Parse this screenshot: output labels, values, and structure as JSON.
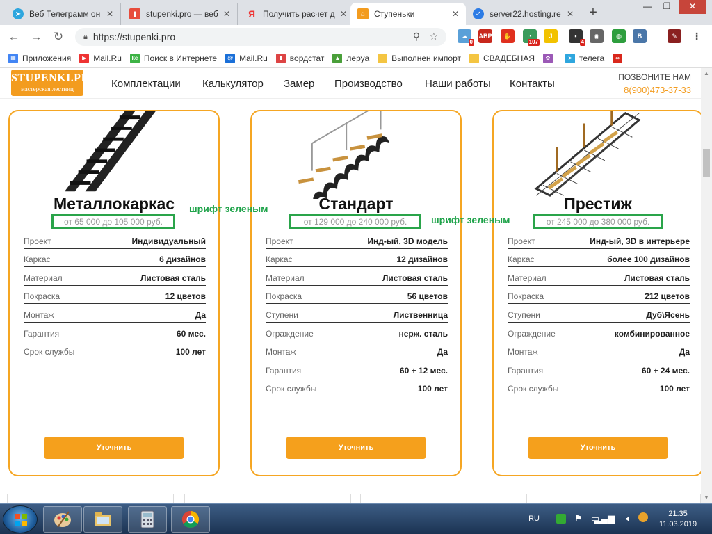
{
  "browser": {
    "tabs": [
      {
        "title": "Веб Телеграмм он",
        "fav_color": "#2ea6de",
        "fav_glyph": "➤"
      },
      {
        "title": "stupenki.pro — веб",
        "fav_color": "#e74c3c",
        "fav_glyph": "▮"
      },
      {
        "title": "Получить расчет д",
        "fav_color": "#ffffff",
        "fav_glyph": "Я"
      },
      {
        "title": "Ступеньки",
        "fav_color": "#f39c1f",
        "fav_glyph": "⌂"
      },
      {
        "title": "server22.hosting.re",
        "fav_color": "#2c7be5",
        "fav_glyph": "✓"
      }
    ],
    "new_tab": "+",
    "url": "https://stupenki.pro",
    "window_controls": {
      "minimize": "—",
      "restore": "❐",
      "close": "✕"
    }
  },
  "extensions": [
    {
      "name": "cloud-ext-icon",
      "label": "☁",
      "badge": "0",
      "color": "#5aa0d8"
    },
    {
      "name": "adblock-icon",
      "label": "ABP",
      "badge": "",
      "color": "#c8281c"
    },
    {
      "name": "stop-ext-icon",
      "label": "✋",
      "badge": "",
      "color": "#e0301e"
    },
    {
      "name": "counter-ext-icon",
      "label": "◔",
      "badge": "107",
      "color": "#3a9b5c"
    },
    {
      "name": "yandex-ext-icon",
      "label": "J",
      "badge": "",
      "color": "#f2c200"
    },
    {
      "name": "mail-ext-icon",
      "label": "▪",
      "badge": "4",
      "color": "#333333"
    },
    {
      "name": "camera-ext-icon",
      "label": "◉",
      "badge": "",
      "color": "#666666"
    },
    {
      "name": "green-ext-icon",
      "label": "◍",
      "badge": "",
      "color": "#2e9e3e"
    },
    {
      "name": "vk-ext-icon",
      "label": "B",
      "badge": "",
      "color": "#4a76a8"
    },
    {
      "name": "brush-ext-icon",
      "label": "✎",
      "badge": "",
      "color": "#8a2020"
    }
  ],
  "bookmarks": [
    {
      "label": "Приложения",
      "color": "#4285f4",
      "glyph": "▦"
    },
    {
      "label": "Mail.Ru",
      "color": "#e33",
      "glyph": "▶"
    },
    {
      "label": "Поиск в Интернете",
      "color": "#3db345",
      "glyph": "ke"
    },
    {
      "label": "Mail.Ru",
      "color": "#1a6fd8",
      "glyph": "@"
    },
    {
      "label": "вордстат",
      "color": "#d44",
      "glyph": "▮"
    },
    {
      "label": "леруа",
      "color": "#4a9f3a",
      "glyph": "▲"
    },
    {
      "label": "Выполнен импорт",
      "color": "#f4c542",
      "glyph": ""
    },
    {
      "label": "СВАДЕБНАЯ",
      "color": "#f4c542",
      "glyph": ""
    },
    {
      "label": "",
      "color": "#9b59b6",
      "glyph": "✿"
    },
    {
      "label": "телега",
      "color": "#2ea6de",
      "glyph": "➤"
    },
    {
      "label": "",
      "color": "#d9281c",
      "glyph": "∞"
    }
  ],
  "site": {
    "logo_line1": "STUPENKI.PRO",
    "logo_line2": "мастерская лестниц",
    "menu": [
      "Комплектации",
      "Калькулятор",
      "Замер",
      "Производство",
      "Наши работы",
      "Контакты"
    ],
    "call_label": "ПОЗВОНИТЕ НАМ",
    "phone": "8(900)473-37-33"
  },
  "cards": [
    {
      "title": "Металлокаркас",
      "price": "от 65 000 до 105 000 руб.",
      "rows": [
        {
          "k": "Проект",
          "v": "Индивидуальный"
        },
        {
          "k": "Каркас",
          "v": "6 дизайнов"
        },
        {
          "k": "Материал",
          "v": "Листовая сталь"
        },
        {
          "k": "Покраска",
          "v": "12 цветов"
        },
        {
          "k": "Монтаж",
          "v": "Да"
        },
        {
          "k": "Гарантия",
          "v": "60 мес."
        },
        {
          "k": "Срок службы",
          "v": "100 лет"
        }
      ],
      "button": "Уточнить"
    },
    {
      "title": "Стандарт",
      "price": "от 129 000 до 240 000 руб.",
      "rows": [
        {
          "k": "Проект",
          "v": "Инд-ый, 3D модель"
        },
        {
          "k": "Каркас",
          "v": "12 дизайнов"
        },
        {
          "k": "Материал",
          "v": "Листовая сталь"
        },
        {
          "k": "Покраска",
          "v": "56 цветов"
        },
        {
          "k": "Ступени",
          "v": "Лиственница"
        },
        {
          "k": "Ограждение",
          "v": "нерж. сталь"
        },
        {
          "k": "Монтаж",
          "v": "Да"
        },
        {
          "k": "Гарантия",
          "v": "60 + 12 мес."
        },
        {
          "k": "Срок службы",
          "v": "100 лет"
        }
      ],
      "button": "Уточнить"
    },
    {
      "title": "Престиж",
      "price": "от 245 000 до 380 000 руб.",
      "rows": [
        {
          "k": "Проект",
          "v": "Инд-ый, 3D в интерьере"
        },
        {
          "k": "Каркас",
          "v": "более 100 дизайнов"
        },
        {
          "k": "Материал",
          "v": "Листовая сталь"
        },
        {
          "k": "Покраска",
          "v": "212 цветов"
        },
        {
          "k": "Ступени",
          "v": "Дуб\\Ясень"
        },
        {
          "k": "Ограждение",
          "v": "комбинированное"
        },
        {
          "k": "Монтаж",
          "v": "Да"
        },
        {
          "k": "Гарантия",
          "v": "60 + 24 мес."
        },
        {
          "k": "Срок службы",
          "v": "100 лет"
        }
      ],
      "button": "Уточнить"
    }
  ],
  "annotations": [
    "шрифт зеленым",
    "шрифт зеленым"
  ],
  "taskbar": {
    "lang": "RU",
    "time": "21:35",
    "date": "11.03.2019",
    "apps": [
      "paint-app-icon",
      "explorer-app-icon",
      "calculator-app-icon",
      "chrome-app-icon"
    ]
  },
  "colors": {
    "accent": "#f5a623",
    "highlight_box": "#2aa44a",
    "annotation_text": "#1fa34a"
  }
}
